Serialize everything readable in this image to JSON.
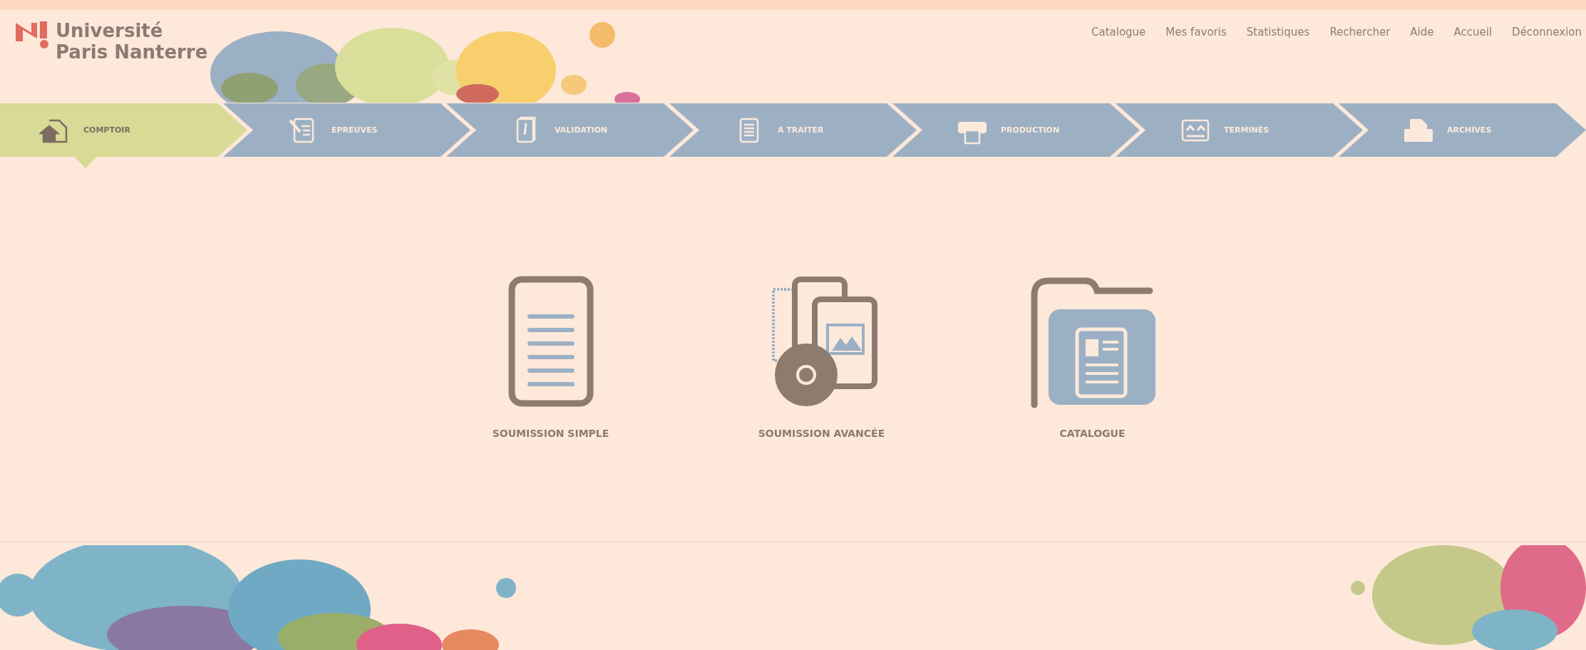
{
  "logo": {
    "lines": [
      "Université",
      "Paris Nanterre"
    ]
  },
  "nav": [
    "Catalogue",
    "Mes favoris",
    "Statistiques",
    "Rechercher",
    "Aide",
    "Accueil",
    "Déconnexion"
  ],
  "steps": [
    {
      "label": "COMPTOIR",
      "kind": "home",
      "selected": true
    },
    {
      "label": "EPREUVES",
      "kind": "proof",
      "selected": false
    },
    {
      "label": "VALIDATION",
      "kind": "validate",
      "selected": false
    },
    {
      "label": "A TRAITER",
      "kind": "todo",
      "selected": false
    },
    {
      "label": "PRODUCTION",
      "kind": "print",
      "selected": false
    },
    {
      "label": "TERMINÉS",
      "kind": "done",
      "selected": false
    },
    {
      "label": "ARCHIVES",
      "kind": "archive",
      "selected": false
    }
  ],
  "tiles": [
    {
      "label": "SOUMISSION SIMPLE",
      "kind": "document"
    },
    {
      "label": "SOUMISSION AVANCÉE",
      "kind": "media"
    },
    {
      "label": "CATALOGUE",
      "kind": "folder"
    }
  ]
}
